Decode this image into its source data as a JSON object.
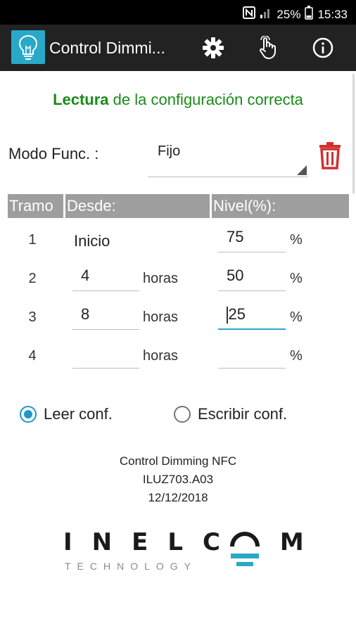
{
  "status_bar": {
    "battery": "25%",
    "time": "15:33"
  },
  "app_bar": {
    "title": "Control Dimmi...",
    "icons": [
      "lightbulb-icon",
      "gear-icon",
      "hand-pointer-icon",
      "info-icon"
    ]
  },
  "status_message": {
    "bold": "Lectura",
    "rest": " de la configuración correcta",
    "color": "#1a8a1a"
  },
  "modo": {
    "label": "Modo Func. :",
    "value": "Fijo"
  },
  "table": {
    "headers": {
      "tramo": "Tramo",
      "desde": "Desde:",
      "nivel": "Nivel(%):"
    },
    "rows": [
      {
        "num": "1",
        "desde": "Inicio",
        "unit_desde": "",
        "nivel": "75",
        "unit_nivel": "%"
      },
      {
        "num": "2",
        "desde": "4",
        "unit_desde": "horas",
        "nivel": "50",
        "unit_nivel": "%"
      },
      {
        "num": "3",
        "desde": "8",
        "unit_desde": "horas",
        "nivel": "25",
        "unit_nivel": "%"
      },
      {
        "num": "4",
        "desde": "",
        "unit_desde": "horas",
        "nivel": "",
        "unit_nivel": "%"
      }
    ]
  },
  "radios": {
    "read": {
      "label": "Leer conf.",
      "checked": true
    },
    "write": {
      "label": "Escribir conf.",
      "checked": false
    }
  },
  "footer": {
    "app_name": "Control Dimming NFC",
    "version": "ILUZ703.A03",
    "date": "12/12/2018"
  },
  "brand": {
    "name": "INELCOM",
    "tagline": "TECHNOLOGY",
    "accent": "#29a9c7"
  },
  "colors": {
    "accent": "#29a9c7",
    "app_bar": "#222222",
    "header_grey": "#9e9e9e",
    "delete_red": "#d32f2f"
  }
}
